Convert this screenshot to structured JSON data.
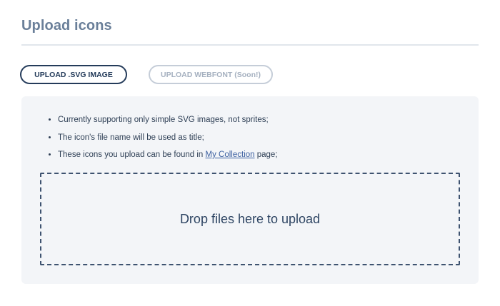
{
  "header": {
    "title": "Upload icons"
  },
  "tabs": {
    "upload_svg_label": "UPLOAD .SVG IMAGE",
    "upload_webfont_label": "UPLOAD WEBFONT (Soon!)"
  },
  "info": {
    "items": [
      "Currently supporting only simple SVG images, not sprites;",
      "The icon's file name will be used as title;"
    ],
    "collection_prefix": "These icons you upload can be found in ",
    "collection_link": "My Collection",
    "collection_suffix": " page;"
  },
  "dropzone": {
    "label": "Drop files here to upload"
  },
  "colors": {
    "accent": "#243b5a",
    "title": "#6a7f99",
    "link": "#3b5fa0",
    "panel_bg": "#f3f5f8",
    "disabled": "#a6b1c0"
  }
}
